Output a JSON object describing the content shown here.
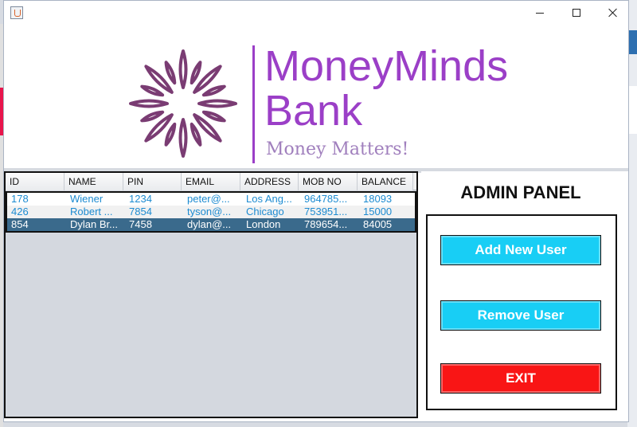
{
  "window": {
    "controls": [
      "minimize",
      "maximize",
      "close"
    ],
    "icon": "java-cup-icon"
  },
  "brand": {
    "line1": "MoneyMinds",
    "line2": "Bank",
    "tagline": "Money Matters!",
    "colors": {
      "primary": "#9b3fc7",
      "mark": "#7a3c73",
      "tagline": "#a07fbd"
    }
  },
  "table": {
    "columns": [
      "ID",
      "NAME",
      "PIN",
      "EMAIL",
      "ADDRESS",
      "MOB NO",
      "BALANCE"
    ],
    "rows": [
      [
        "178",
        "Wiener",
        "1234",
        "peter@...",
        "Los Ang...",
        "964785...",
        "18093"
      ],
      [
        "426",
        "Robert ...",
        "7854",
        "tyson@...",
        "Chicago",
        "753951...",
        "15000"
      ],
      [
        "854",
        "Dylan Br...",
        "7458",
        "dylan@...",
        "London",
        "789654...",
        "84005"
      ]
    ],
    "selected_row_index": 2,
    "colors": {
      "text": "#1d8bd1",
      "selected_bg": "#3a6a8c"
    }
  },
  "admin": {
    "title": "ADMIN PANEL",
    "add_user": "Add New User",
    "remove_user": "Remove User",
    "exit": "EXIT",
    "colors": {
      "action": "#18cef5",
      "exit": "#f91515"
    }
  }
}
